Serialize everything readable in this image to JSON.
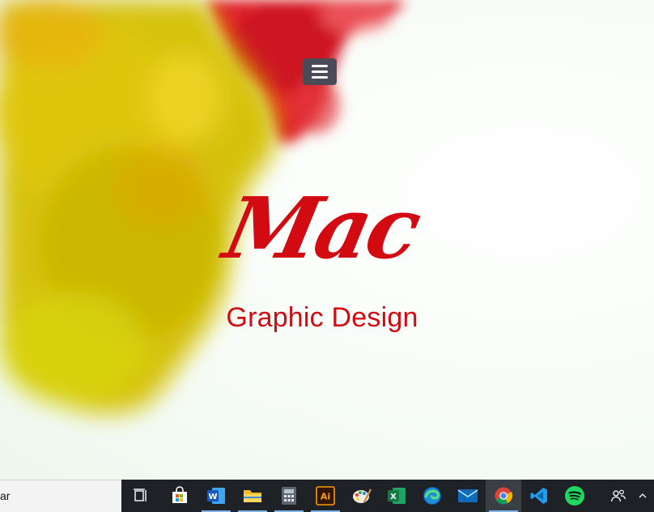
{
  "hero": {
    "menu_icon": "hamburger-menu-icon",
    "logo_script": "Mac",
    "logo_subtitle": "Graphic Design"
  },
  "taskbar": {
    "search_text": "ar",
    "icons": [
      "task-view-icon",
      "microsoft-store-icon",
      "word-icon",
      "file-explorer-icon",
      "calculator-icon",
      "illustrator-icon",
      "paint-icon",
      "excel-icon",
      "edge-icon",
      "mail-icon",
      "chrome-icon",
      "vscode-icon",
      "spotify-icon",
      "people-icon",
      "tray-chevron-icon"
    ],
    "word_letter": "W",
    "excel_letter": "X",
    "illustrator_letters": "Ai"
  },
  "colors": {
    "brand_red": "#d20a12",
    "menu_button": "#4d4a58",
    "taskbar": "#1e2227"
  }
}
